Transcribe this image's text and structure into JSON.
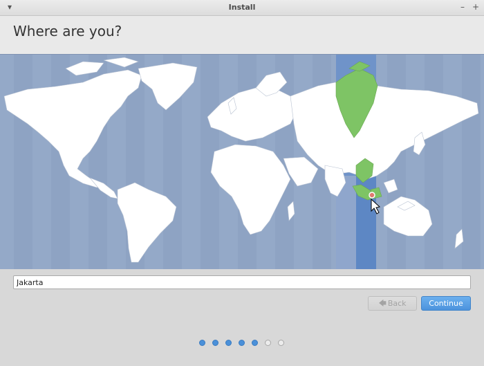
{
  "window": {
    "title": "Install"
  },
  "page": {
    "heading": "Where are you?"
  },
  "location": {
    "value": "Jakarta",
    "selected_timezone_color": "#7ec465",
    "highlight_band_color": "#5d87c4"
  },
  "buttons": {
    "back_label": "Back",
    "continue_label": "Continue"
  },
  "progress": {
    "total_steps": 7,
    "completed_steps": 5
  }
}
